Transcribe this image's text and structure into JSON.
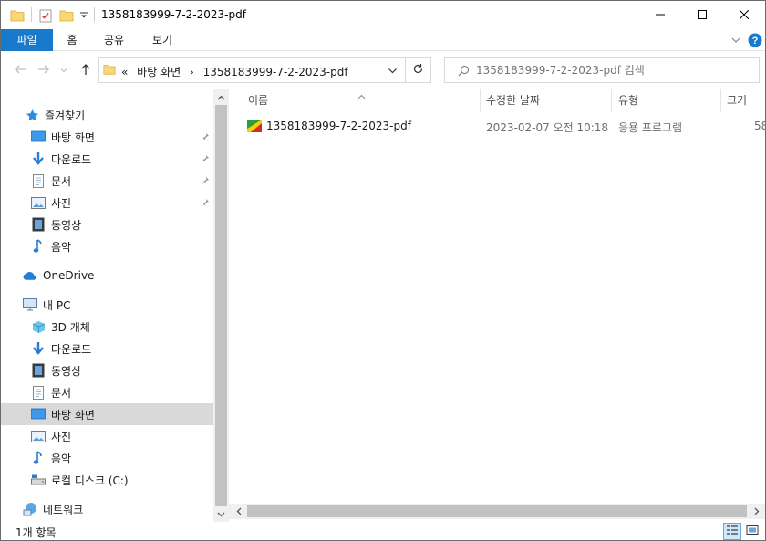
{
  "window": {
    "title": "1358183999-7-2-2023-pdf",
    "controls": {
      "minimize": "minimize-icon",
      "maximize": "maximize-icon",
      "close": "close-icon"
    }
  },
  "ribbon": {
    "tabs": [
      {
        "label": "파일"
      },
      {
        "label": "홈"
      },
      {
        "label": "공유"
      },
      {
        "label": "보기"
      }
    ]
  },
  "address": {
    "prefix": "«",
    "crumbs": [
      "바탕 화면",
      "1358183999-7-2-2023-pdf"
    ]
  },
  "search": {
    "placeholder": "1358183999-7-2-2023-pdf 검색"
  },
  "navpane": {
    "quick_access": "즐겨찾기",
    "quick_items": [
      "바탕 화면",
      "다운로드",
      "문서",
      "사진",
      "동영상",
      "음악"
    ],
    "onedrive": "OneDrive",
    "this_pc": "내 PC",
    "pc_items": [
      "3D 개체",
      "다운로드",
      "동영상",
      "문서",
      "바탕 화면",
      "사진",
      "음악",
      "로컬 디스크 (C:)"
    ],
    "network": "네트워크"
  },
  "columns": {
    "name": "이름",
    "date": "수정한 날짜",
    "type": "유형",
    "size": "크기"
  },
  "files": [
    {
      "name": "1358183999-7-2-2023-pdf",
      "date": "2023-02-07 오전 10:18",
      "type": "응용 프로그램",
      "size": "58"
    }
  ],
  "status": {
    "item_count": "1개 항목"
  },
  "colors": {
    "accent": "#1979ca",
    "selected": "#d9d9d9",
    "scrollbar": "#c2c2c2"
  }
}
